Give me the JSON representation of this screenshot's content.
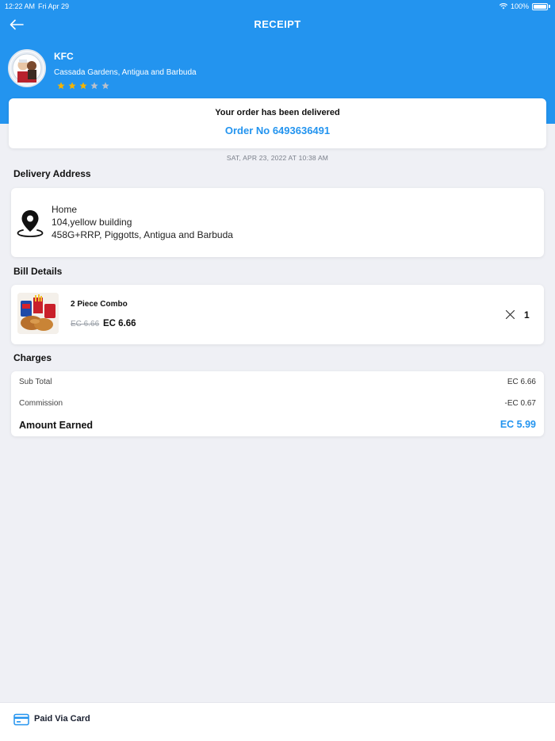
{
  "status_bar": {
    "time": "12:22 AM",
    "date": "Fri Apr 29",
    "battery": "100%"
  },
  "header": {
    "title": "RECEIPT"
  },
  "restaurant": {
    "name": "KFC",
    "address": "Cassada Gardens, Antigua and Barbuda",
    "rating": 3,
    "rating_max": 5
  },
  "order": {
    "status_text": "Your order has been delivered",
    "order_number": "Order No 6493636491",
    "datetime": "SAT, APR 23, 2022 AT 10:38 AM"
  },
  "delivery": {
    "section_title": "Delivery Address",
    "label": "Home",
    "line1": "104,yellow building",
    "line2": "458G+RRP, Piggotts, Antigua and Barbuda"
  },
  "bill": {
    "section_title": "Bill Details",
    "items": [
      {
        "name": "2 Piece Combo",
        "original_price": "EC 6.66",
        "price": "EC 6.66",
        "quantity": "1"
      }
    ]
  },
  "charges": {
    "section_title": "Charges",
    "rows": [
      {
        "label": "Sub Total",
        "value": "EC 6.66"
      },
      {
        "label": "Commission",
        "value": "-EC 0.67"
      }
    ],
    "total_label": "Amount Earned",
    "total_value": "EC 5.99"
  },
  "footer": {
    "payment_label": "Paid Via Card"
  },
  "colors": {
    "accent": "#2394ef",
    "star_filled": "#f5b400",
    "star_empty": "#b8c0cc",
    "background": "#eff0f5"
  },
  "icons": {
    "back": "arrow-left-icon",
    "location": "location-pin-icon",
    "remove": "close-icon",
    "payment": "credit-card-icon"
  }
}
